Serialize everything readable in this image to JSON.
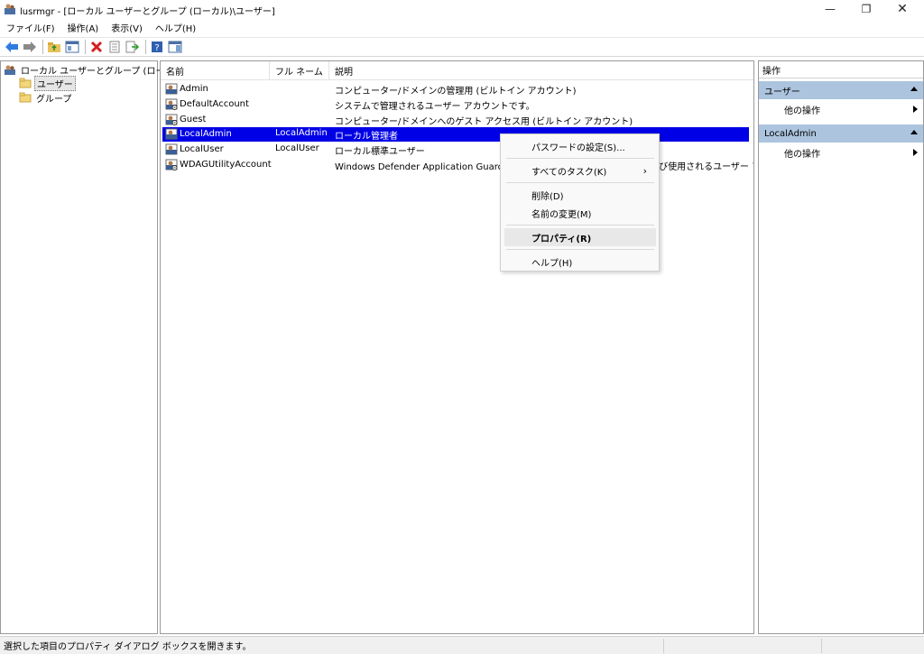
{
  "window": {
    "title": "lusrmgr - [ローカル ユーザーとグループ (ローカル)\\ユーザー]",
    "min_symbol": "—",
    "max_symbol": "❐",
    "close_symbol": "✕"
  },
  "menu": [
    "ファイル(F)",
    "操作(A)",
    "表示(V)",
    "ヘルプ(H)"
  ],
  "toolbar_icons": [
    "back-arrow-icon",
    "forward-arrow-icon",
    "up-folder-icon",
    "show-hide-tree-icon",
    "delete-icon",
    "properties-icon",
    "export-list-icon",
    "help-icon",
    "action-pane-icon"
  ],
  "tree": {
    "root": "ローカル ユーザーとグループ (ローカル)",
    "children": [
      "ユーザー",
      "グループ"
    ]
  },
  "list": {
    "headers": [
      "名前",
      "フル ネーム",
      "説明"
    ],
    "rows": [
      {
        "name": "Admin",
        "fullname": "",
        "desc": "コンピューター/ドメインの管理用 (ビルトイン アカウント)"
      },
      {
        "name": "DefaultAccount",
        "fullname": "",
        "desc": "システムで管理されるユーザー アカウントです。"
      },
      {
        "name": "Guest",
        "fullname": "",
        "desc": "コンピューター/ドメインへのゲスト アクセス用 (ビルトイン アカウント)"
      },
      {
        "name": "LocalAdmin",
        "fullname": "LocalAdmin",
        "desc": "ローカル管理者"
      },
      {
        "name": "LocalUser",
        "fullname": "LocalUser",
        "desc": "ローカル標準ユーザー"
      },
      {
        "name": "WDAGUtilityAccount",
        "fullname": "",
        "desc": "Windows Defender Application Guard シナリオでシステムによって管理および使用されるユーザー アカウント"
      }
    ]
  },
  "context_menu": {
    "set_password": "パスワードの設定(S)...",
    "all_tasks": "すべてのタスク(K)",
    "delete": "削除(D)",
    "rename": "名前の変更(M)",
    "properties": "プロパティ(R)",
    "help": "ヘルプ(H)",
    "submenu_arrow": "›"
  },
  "actions": {
    "title": "操作",
    "section1": "ユーザー",
    "section1_item": "他の操作",
    "section2": "LocalAdmin",
    "section2_item": "他の操作"
  },
  "status": {
    "text": "選択した項目のプロパティ ダイアログ ボックスを開きます。"
  }
}
